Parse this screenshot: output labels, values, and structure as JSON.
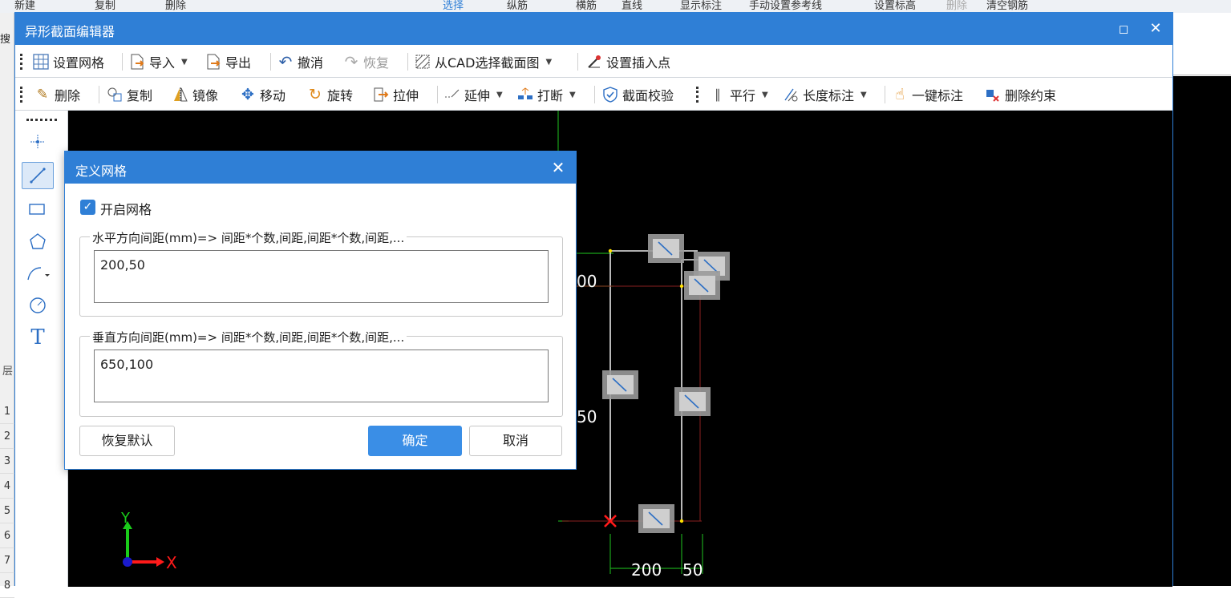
{
  "background_app": {
    "top_items": [
      "新建",
      "复制",
      "删除",
      "选择",
      "纵筋",
      "横筋",
      "直线",
      "显示标注",
      "手动设置参考线",
      "设置标高",
      "删除",
      "清空钢筋"
    ],
    "search_label": "搜",
    "side_char": "层",
    "row_numbers": [
      "1",
      "2",
      "3",
      "4",
      "5",
      "6",
      "7",
      "8"
    ]
  },
  "editor": {
    "title": "异形截面编辑器",
    "maximize_glyph": "◻",
    "close_glyph": "✕",
    "toolbar1": {
      "set_grid": "设置网格",
      "import": "导入",
      "export": "导出",
      "undo": "撤消",
      "redo": "恢复",
      "select_from_cad": "从CAD选择截面图",
      "set_insert_point": "设置插入点"
    },
    "toolbar2": {
      "delete": "删除",
      "copy": "复制",
      "mirror": "镜像",
      "move": "移动",
      "rotate": "旋转",
      "stretch": "拉伸",
      "extend": "延伸",
      "break": "打断",
      "section_check": "截面校验",
      "parallel": "平行",
      "length_dim": "长度标注",
      "one_click_dim": "一键标注",
      "delete_constraint": "删除约束"
    },
    "palette": [
      "point-tool",
      "line-tool",
      "rectangle-tool",
      "polygon-tool",
      "arc-tool",
      "circle-tool",
      "text-tool"
    ],
    "canvas": {
      "dim_labels": [
        "200",
        "50"
      ],
      "partial_labels": [
        "00",
        "50"
      ],
      "axis_x": "X",
      "axis_y": "Y"
    }
  },
  "dialog": {
    "title": "定义网格",
    "close_glyph": "✕",
    "enable_grid_label": "开启网格",
    "enable_grid_checked": true,
    "horizontal_legend": "水平方向间距(mm)=> 间距*个数,间距,间距*个数,间距,...",
    "horizontal_value": "200,50",
    "vertical_legend": "垂直方向间距(mm)=> 间距*个数,间距,间距*个数,间距,...",
    "vertical_value": "650,100",
    "restore_default": "恢复默认",
    "ok": "确定",
    "cancel": "取消"
  },
  "colors": {
    "accent": "#2f7fd6",
    "canvas_bg": "#000000",
    "dimension_green": "#1aa31a",
    "section_outline": "#e0e0e0",
    "constraint_red": "#8a1f1f",
    "origin_red": "#ff1a1a"
  }
}
